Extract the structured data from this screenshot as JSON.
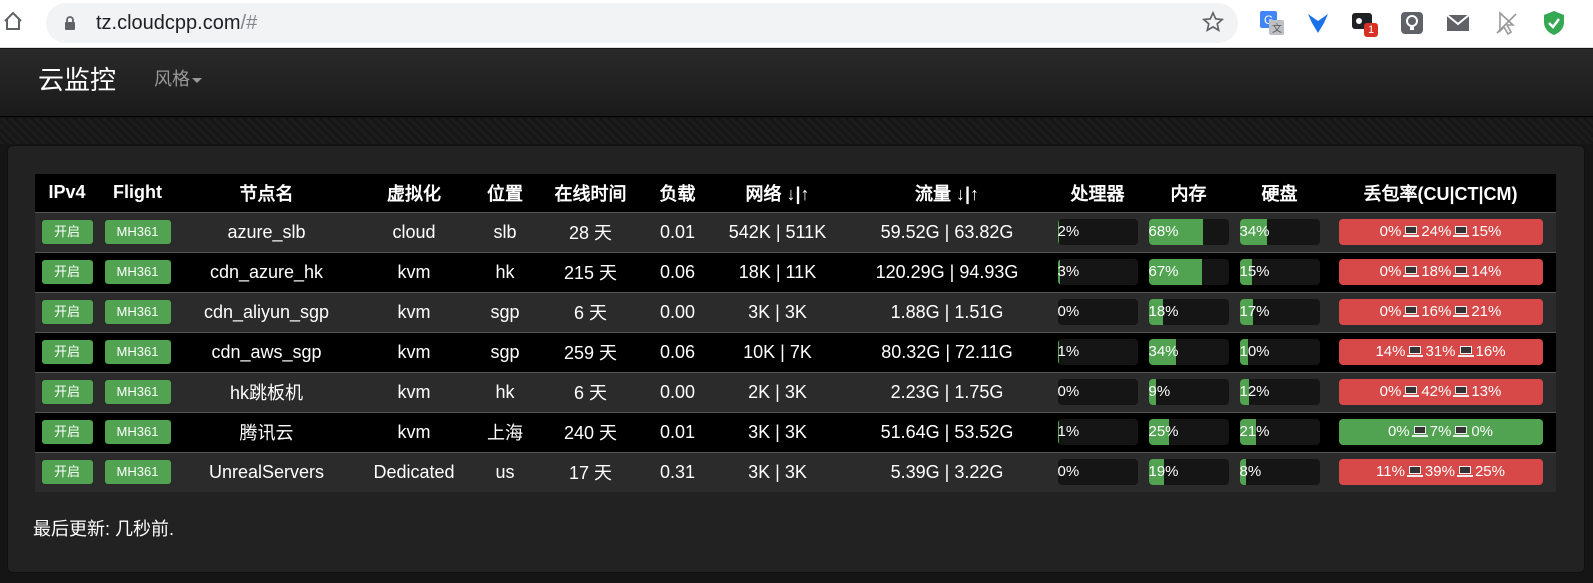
{
  "browser": {
    "url_host": "tz.cloudcpp.com",
    "url_path": "/#",
    "extension_badge": "1"
  },
  "navbar": {
    "brand": "云监控",
    "style_menu": "风格"
  },
  "table": {
    "headers": [
      "IPv4",
      "Flight",
      "节点名",
      "虚拟化",
      "位置",
      "在线时间",
      "负载",
      "网络 ↓|↑",
      "流量 ↓|↑",
      "处理器",
      "内存",
      "硬盘",
      "丢包率(CU|CT|CM)"
    ],
    "rows": [
      {
        "ipv4": "开启",
        "flight": "MH361",
        "name": "azure_slb",
        "virt": "cloud",
        "loc": "slb",
        "uptime": "28 天",
        "load": "0.01",
        "network": "542K | 511K",
        "traffic": "59.52G | 63.82G",
        "cpu": "2%",
        "cpu_val": 2,
        "mem": "68%",
        "mem_val": 68,
        "disk": "34%",
        "disk_val": 34,
        "loss": [
          "0%",
          "24%",
          "15%"
        ],
        "loss_color": "red"
      },
      {
        "ipv4": "开启",
        "flight": "MH361",
        "name": "cdn_azure_hk",
        "virt": "kvm",
        "loc": "hk",
        "uptime": "215 天",
        "load": "0.06",
        "network": "18K | 11K",
        "traffic": "120.29G | 94.93G",
        "cpu": "3%",
        "cpu_val": 3,
        "mem": "67%",
        "mem_val": 67,
        "disk": "15%",
        "disk_val": 15,
        "loss": [
          "0%",
          "18%",
          "14%"
        ],
        "loss_color": "red"
      },
      {
        "ipv4": "开启",
        "flight": "MH361",
        "name": "cdn_aliyun_sgp",
        "virt": "kvm",
        "loc": "sgp",
        "uptime": "6 天",
        "load": "0.00",
        "network": "3K | 3K",
        "traffic": "1.88G | 1.51G",
        "cpu": "0%",
        "cpu_val": 0,
        "mem": "18%",
        "mem_val": 18,
        "disk": "17%",
        "disk_val": 17,
        "loss": [
          "0%",
          "16%",
          "21%"
        ],
        "loss_color": "red"
      },
      {
        "ipv4": "开启",
        "flight": "MH361",
        "name": "cdn_aws_sgp",
        "virt": "kvm",
        "loc": "sgp",
        "uptime": "259 天",
        "load": "0.06",
        "network": "10K | 7K",
        "traffic": "80.32G | 72.11G",
        "cpu": "1%",
        "cpu_val": 1,
        "mem": "34%",
        "mem_val": 34,
        "disk": "10%",
        "disk_val": 10,
        "loss": [
          "14%",
          "31%",
          "16%"
        ],
        "loss_color": "red"
      },
      {
        "ipv4": "开启",
        "flight": "MH361",
        "name": "hk跳板机",
        "virt": "kvm",
        "loc": "hk",
        "uptime": "6 天",
        "load": "0.00",
        "network": "2K | 3K",
        "traffic": "2.23G | 1.75G",
        "cpu": "0%",
        "cpu_val": 0,
        "mem": "9%",
        "mem_val": 9,
        "disk": "12%",
        "disk_val": 12,
        "loss": [
          "0%",
          "42%",
          "13%"
        ],
        "loss_color": "red"
      },
      {
        "ipv4": "开启",
        "flight": "MH361",
        "name": "腾讯云",
        "virt": "kvm",
        "loc": "上海",
        "uptime": "240 天",
        "load": "0.01",
        "network": "3K | 3K",
        "traffic": "51.64G | 53.52G",
        "cpu": "1%",
        "cpu_val": 1,
        "mem": "25%",
        "mem_val": 25,
        "disk": "21%",
        "disk_val": 21,
        "loss": [
          "0%",
          "7%",
          "0%"
        ],
        "loss_color": "green"
      },
      {
        "ipv4": "开启",
        "flight": "MH361",
        "name": "UnrealServers",
        "virt": "Dedicated",
        "loc": "us",
        "uptime": "17 天",
        "load": "0.31",
        "network": "3K | 3K",
        "traffic": "5.39G | 3.22G",
        "cpu": "0%",
        "cpu_val": 0,
        "mem": "19%",
        "mem_val": 19,
        "disk": "8%",
        "disk_val": 8,
        "loss": [
          "11%",
          "39%",
          "25%"
        ],
        "loss_color": "red"
      }
    ]
  },
  "footer": {
    "updated": "最后更新: 几秒前."
  },
  "colors": {
    "green": "#51a351",
    "red": "#d74848"
  }
}
